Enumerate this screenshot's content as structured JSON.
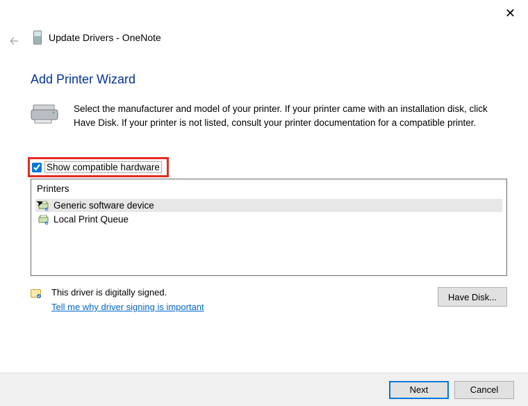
{
  "window": {
    "title": "Update Drivers - OneNote"
  },
  "wizard": {
    "heading": "Add Printer Wizard",
    "description": "Select the manufacturer and model of your printer. If your printer came with an installation disk, click Have Disk. If your printer is not listed, consult your printer documentation for a compatible printer."
  },
  "checkbox": {
    "label": "Show compatible hardware",
    "checked": true
  },
  "list": {
    "header": "Printers",
    "items": [
      {
        "label": "Generic software device",
        "selected": true
      },
      {
        "label": "Local Print Queue",
        "selected": false
      }
    ]
  },
  "signature": {
    "status": "This driver is digitally signed.",
    "link": "Tell me why driver signing is important"
  },
  "buttons": {
    "have_disk": "Have Disk...",
    "next": "Next",
    "cancel": "Cancel"
  }
}
